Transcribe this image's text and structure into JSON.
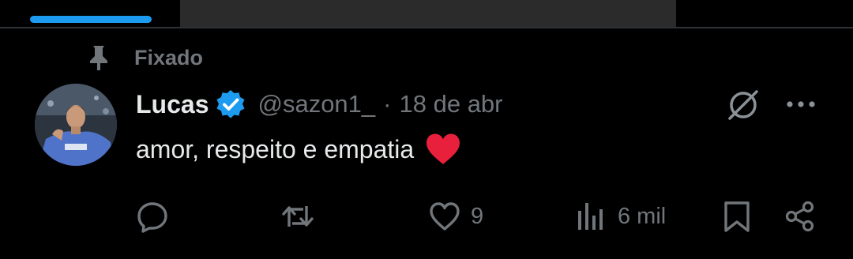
{
  "pinned": {
    "label": "Fixado"
  },
  "author": {
    "name": "Lucas",
    "handle": "@sazon1_",
    "verified": true
  },
  "meta": {
    "separator": "·",
    "date": "18 de abr"
  },
  "tweet": {
    "text": "amor, respeito e empatia",
    "emoji": "red-heart"
  },
  "actions": {
    "reply_count": "",
    "repost_count": "",
    "like_count": "9",
    "views_count": "6 mil"
  },
  "colors": {
    "accent": "#1d9bf0",
    "muted": "#71767b",
    "text": "#e7e9ea",
    "heart": "#e8203b"
  }
}
